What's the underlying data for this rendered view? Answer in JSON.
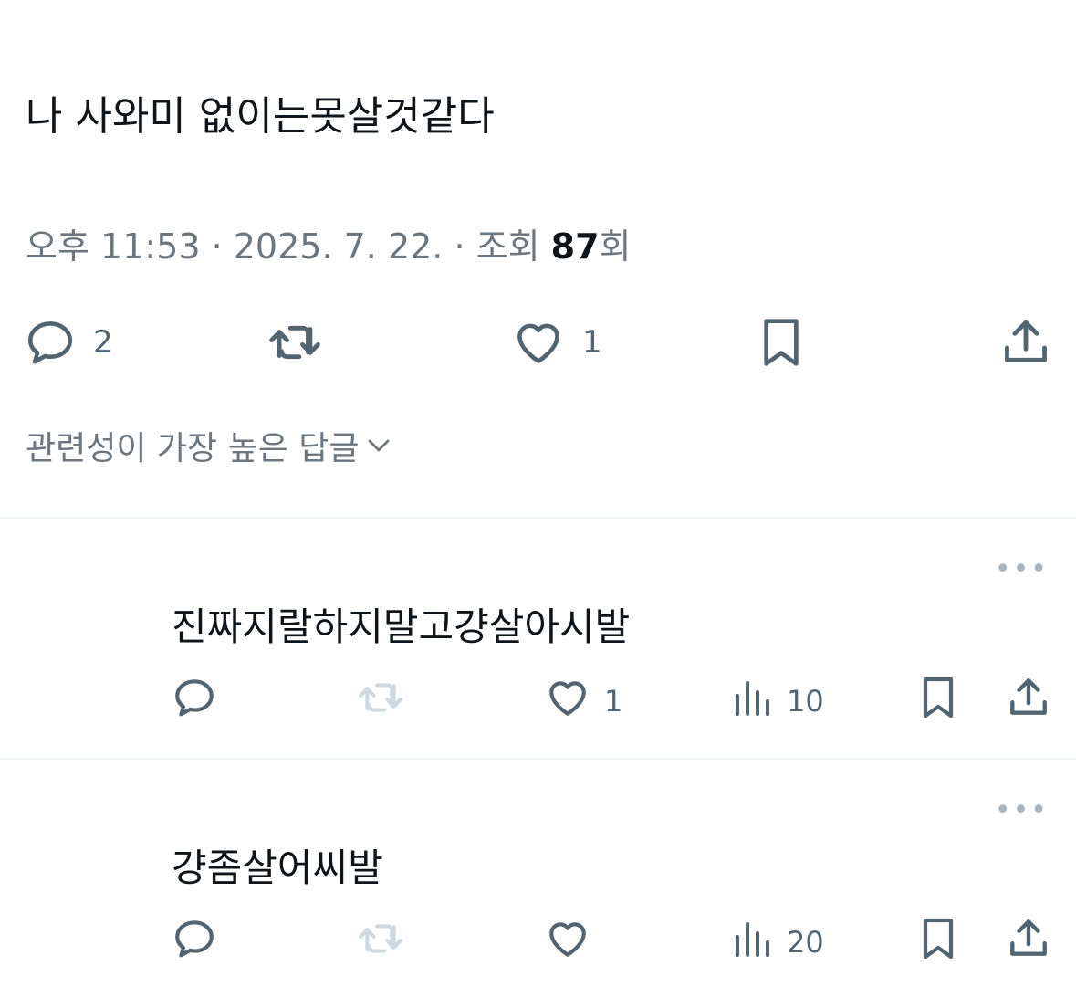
{
  "tweet": {
    "text": "나 사와미 없이는못살것같다",
    "time": "오후 11:53 · 2025. 7. 22. · 조회 ",
    "views": "87",
    "views_suffix": "회",
    "reply_count": "2",
    "like_count": "1"
  },
  "sort_label": "관련성이 가장 높은 답글",
  "replies": [
    {
      "more": "•••",
      "text": "진짜지랄하지말고걍살아시발",
      "like_count": "1",
      "view_count": "10"
    },
    {
      "more": "•••",
      "text": "걍좀살어씨발",
      "like_count": "",
      "view_count": "20"
    }
  ],
  "icons": {
    "reply": "reply-icon",
    "retweet": "retweet-icon",
    "like": "heart-icon",
    "bookmark": "bookmark-icon",
    "share": "share-icon",
    "views": "views-icon",
    "sort": "chevron-down-icon"
  },
  "colors": {
    "text": "#0f1419",
    "secondary": "#536471",
    "muted": "#6e767d",
    "divider": "#eff3f4"
  }
}
